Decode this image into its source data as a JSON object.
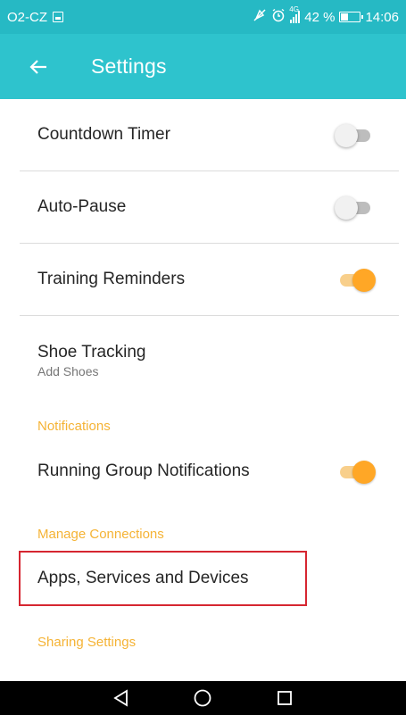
{
  "status_bar": {
    "carrier": "O2-CZ",
    "battery_percent": "42 %",
    "battery_level": 0.42,
    "time": "14:06",
    "network_type": "4G",
    "icons": [
      "sim-icon",
      "mute-icon",
      "alarm-icon",
      "signal-icon",
      "battery-icon"
    ]
  },
  "app_bar": {
    "title": "Settings",
    "back_icon": "arrow-left-icon",
    "color": "#2ec3cd"
  },
  "settings": {
    "countdown_timer": {
      "label": "Countdown Timer",
      "enabled": false
    },
    "auto_pause": {
      "label": "Auto-Pause",
      "enabled": false
    },
    "training_reminders": {
      "label": "Training Reminders",
      "enabled": true
    },
    "shoe_tracking": {
      "label": "Shoe Tracking",
      "sublabel": "Add Shoes"
    }
  },
  "notifications": {
    "header": "Notifications",
    "running_group": {
      "label": "Running Group Notifications",
      "enabled": true
    }
  },
  "manage_connections": {
    "header": "Manage Connections",
    "apps_services": {
      "label": "Apps, Services and Devices"
    }
  },
  "sharing_settings": {
    "header": "Sharing Settings"
  },
  "colors": {
    "accent": "#ffa726",
    "section_header": "#f5b335",
    "highlight": "#d62631"
  },
  "nav_bar": {
    "icons": [
      "back-triangle-icon",
      "home-circle-icon",
      "recents-square-icon"
    ]
  }
}
